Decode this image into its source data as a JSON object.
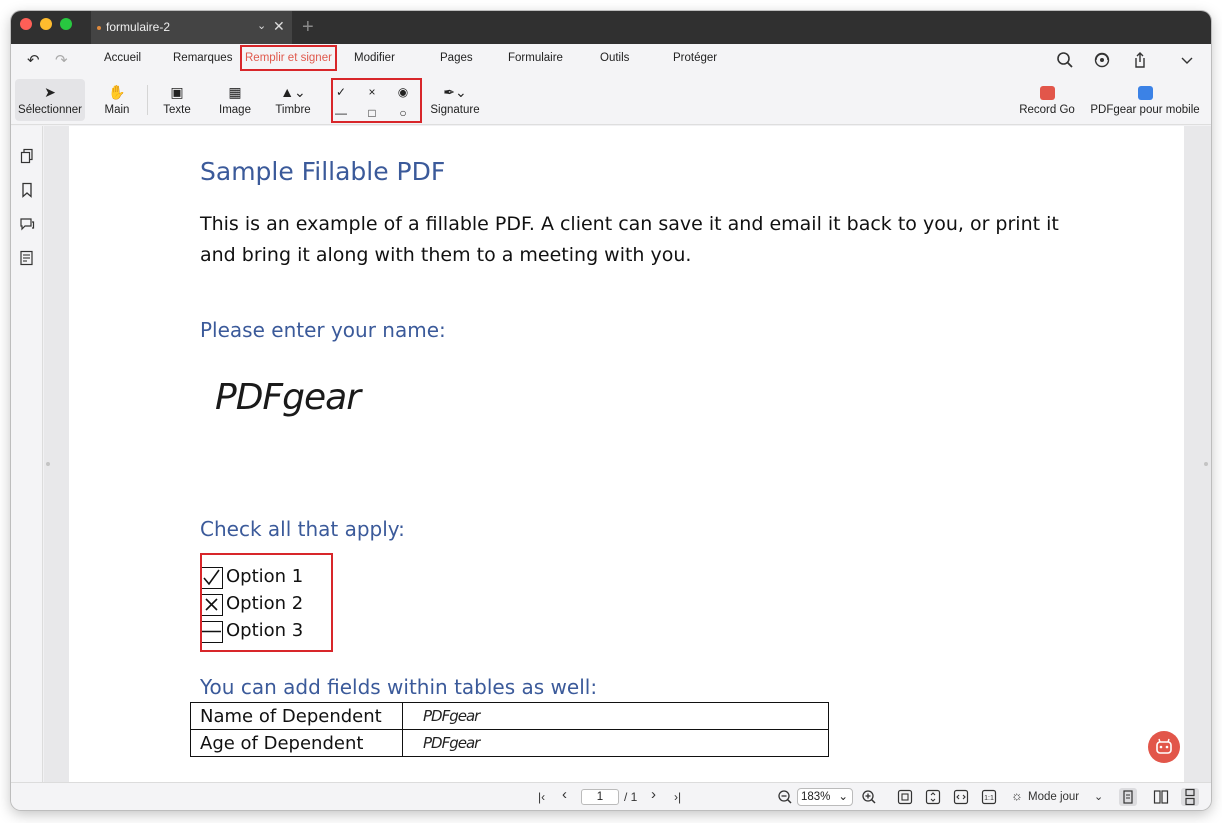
{
  "window": {
    "tab_title": "formulaire-2"
  },
  "menu": {
    "items": [
      "Accueil",
      "Remarques",
      "Remplir et signer",
      "Modifier",
      "Pages",
      "Formulaire",
      "Outils",
      "Protéger"
    ],
    "active": "Remplir et signer"
  },
  "toolbar": {
    "select": "Sélectionner",
    "hand": "Main",
    "text": "Texte",
    "image": "Image",
    "stamp": "Timbre",
    "signature": "Signature",
    "record_go": "Record Go",
    "mobile": "PDFgear pour mobile",
    "marks": {
      "check": "✓",
      "cross": "×",
      "radio_filled": "◉",
      "line": "—",
      "square": "□",
      "circle": "○"
    }
  },
  "document": {
    "title": "Sample Fillable PDF",
    "intro": "This is an example of a fillable PDF. A client can save it and email it back to you, or print it and bring it along with them to a meeting with you.",
    "name_heading": "Please enter your name:",
    "signature": "PDFgear",
    "check_heading": "Check all that apply:",
    "options": [
      {
        "label": "Option 1",
        "mark": "✓"
      },
      {
        "label": "Option 2",
        "mark": "✕"
      },
      {
        "label": "Option 3",
        "mark": "—"
      }
    ],
    "table_heading": "You can add  fields within tables as well:",
    "table": [
      {
        "label": "Name of Dependent",
        "value": "PDFgear"
      },
      {
        "label": "Age of Dependent",
        "value": "PDFgear"
      }
    ]
  },
  "status": {
    "page_current": "1",
    "page_total": "/ 1",
    "zoom": "183%",
    "mode": "Mode jour"
  },
  "colors": {
    "accent": "#e05a4e",
    "highlight": "#d8262a",
    "heading_blue": "#3b5a9a"
  }
}
